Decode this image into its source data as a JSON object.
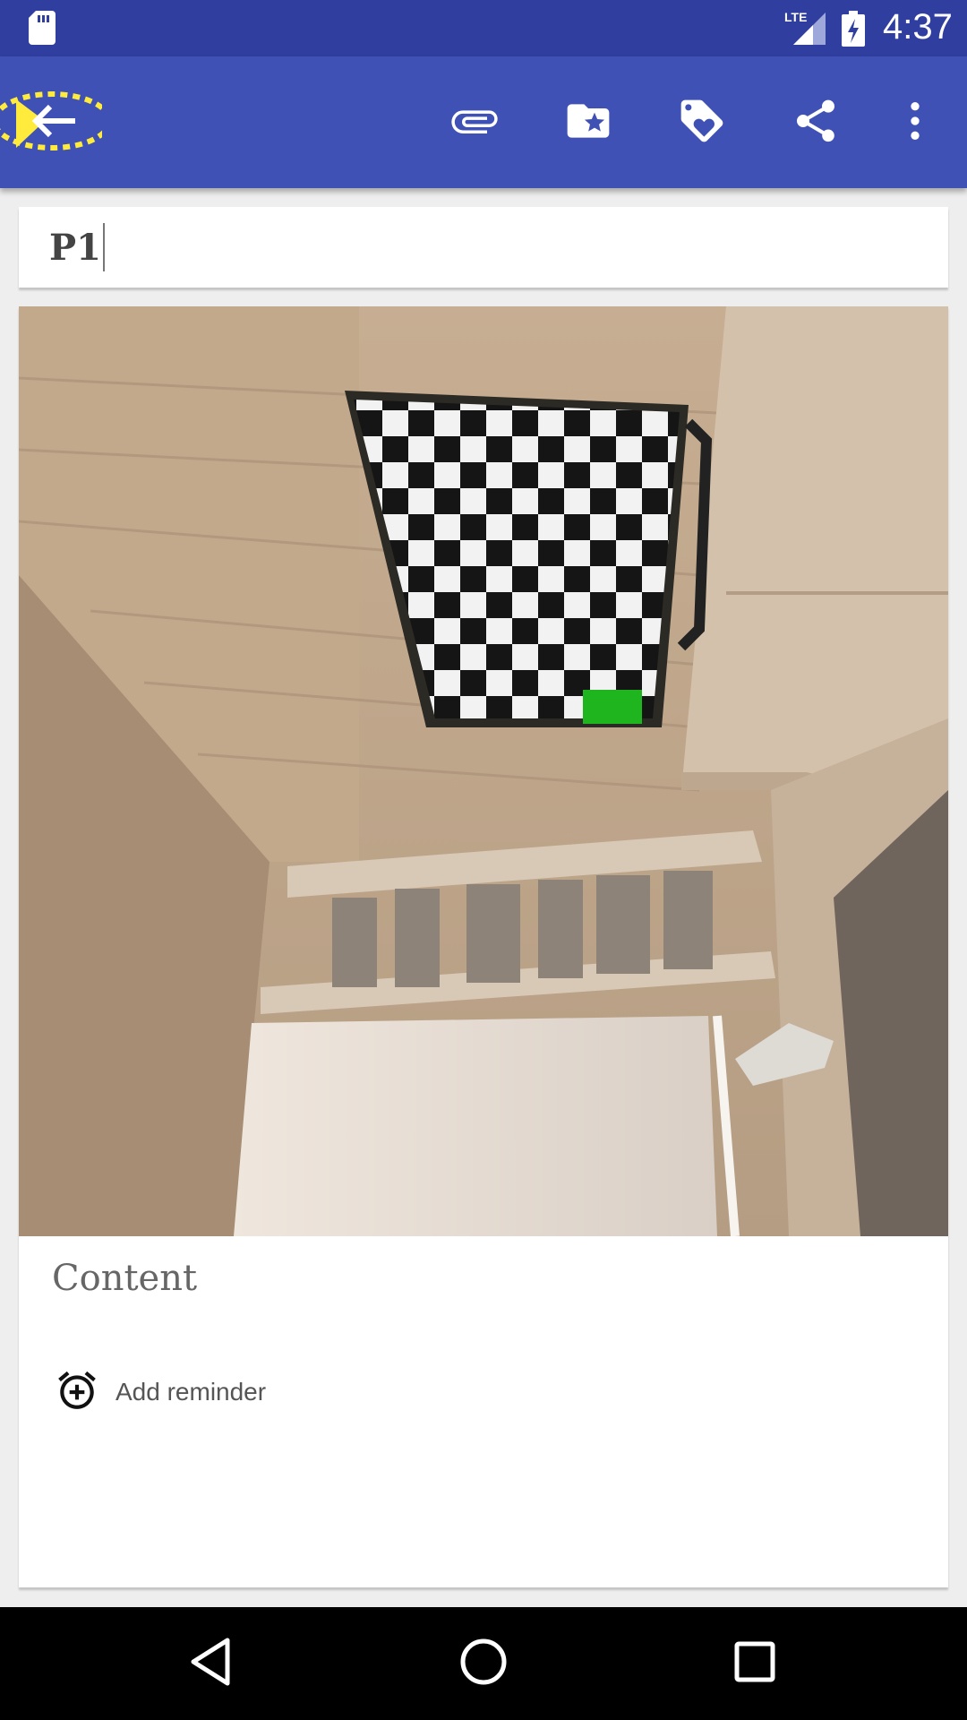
{
  "status_bar": {
    "time": "4:37",
    "network": "LTE",
    "icons": [
      "sd-card-icon",
      "lte-signal-icon",
      "battery-charging-icon"
    ]
  },
  "toolbar": {
    "actions": [
      "back-arrow-icon",
      "attachment-icon",
      "category-icon",
      "tag-icon",
      "share-icon",
      "more-options-icon"
    ]
  },
  "note": {
    "title": "P1",
    "content_placeholder": "Content",
    "image_description": "room-photo",
    "reminder_label": "Add reminder"
  },
  "nav_bar": {
    "buttons": [
      "back-nav-icon",
      "home-nav-icon",
      "recents-nav-icon"
    ]
  },
  "colors": {
    "status_bar": "#303f9f",
    "app_bar": "#3f51b5",
    "background": "#eeeeee",
    "card": "#ffffff"
  }
}
